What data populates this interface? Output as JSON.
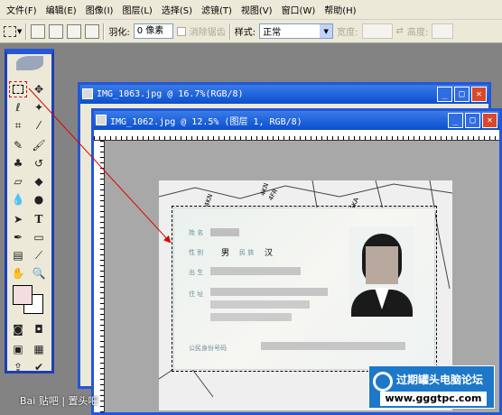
{
  "menu": [
    "文件(F)",
    "编辑(E)",
    "图像(I)",
    "图层(L)",
    "选择(S)",
    "滤镜(T)",
    "视图(V)",
    "窗口(W)",
    "帮助(H)"
  ],
  "options": {
    "feather_label": "羽化:",
    "feather_value": "0 像素",
    "antialias_label": "消除锯齿",
    "style_label": "样式:",
    "style_value": "正常",
    "width_label": "宽度:",
    "height_label": "高度:"
  },
  "windows": {
    "back_title": "IMG_1063.jpg @ 16.7%(RGB/8)",
    "front_title": "IMG_1062.jpg @ 12.5% (图层 1, RGB/8)"
  },
  "ruler_labels": [
    "4",
    "6",
    "8",
    "10",
    "12",
    "14",
    "16",
    "18"
  ],
  "id_card": {
    "name_label": "姓 名",
    "gender_label": "性 别",
    "gender_value": "男",
    "ethnicity_label": "民 族",
    "ethnicity_value": "汉",
    "birth_label": "出 生",
    "address_label": "住 址",
    "id_label": "公民身份号码"
  },
  "doc_bg_text": [
    "4KN",
    "4FR",
    "4KN",
    "5KA",
    "4KN"
  ],
  "watermark": {
    "title": "过期罐头电脑论坛",
    "url": "www.gggtpc.com"
  },
  "baidu_watermark": "Bai 贴吧 | 置头吧",
  "icons": {
    "marquee": "rect-marquee-icon",
    "move": "move-icon",
    "lasso": "lasso-icon",
    "wand": "magic-wand-icon",
    "crop": "crop-icon",
    "slice": "slice-icon",
    "heal": "healing-brush-icon",
    "brush": "brush-icon",
    "stamp": "clone-stamp-icon",
    "history": "history-brush-icon",
    "eraser": "eraser-icon",
    "bucket": "paint-bucket-icon",
    "blur": "blur-icon",
    "dodge": "dodge-icon",
    "path": "path-select-icon",
    "type": "type-icon",
    "pen": "pen-icon",
    "shape": "shape-icon",
    "notes": "notes-icon",
    "eyedropper": "eyedropper-icon",
    "hand": "hand-icon",
    "zoom": "zoom-icon"
  },
  "colors": {
    "selection_marker": "#e00000",
    "xp_blue": "#2356d8",
    "watermark_blue": "#1d78c8"
  }
}
